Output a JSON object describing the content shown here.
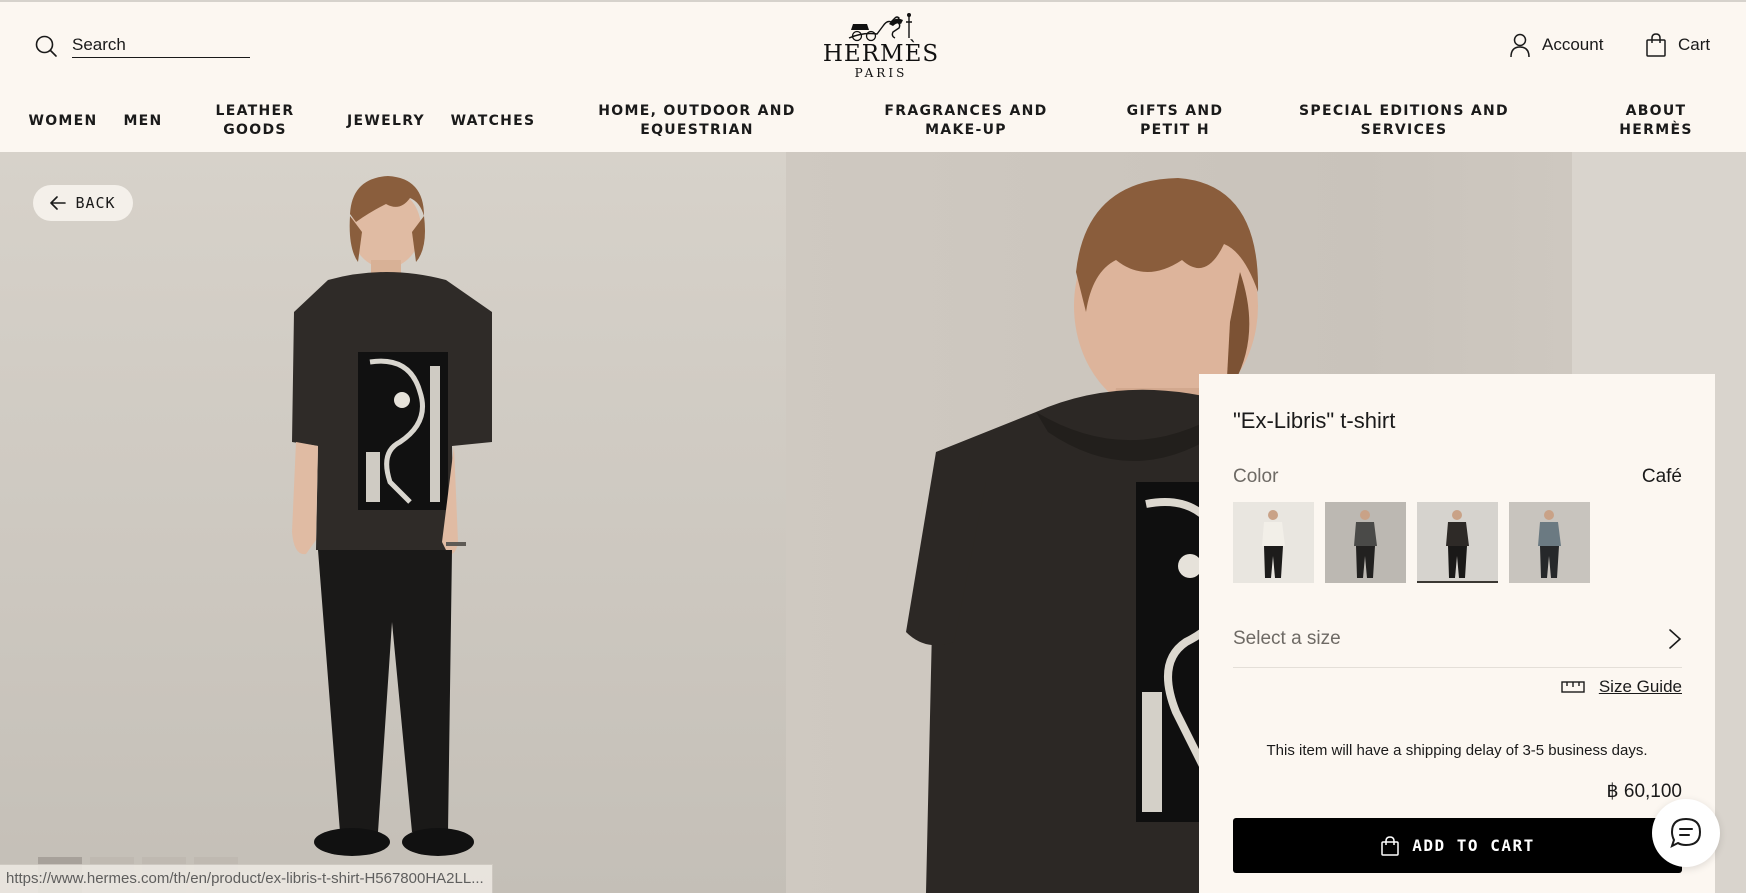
{
  "header": {
    "search": {
      "placeholder": "Search",
      "icon": "search-icon"
    },
    "logo": {
      "brand": "HERMÈS",
      "city": "PARIS"
    },
    "account": {
      "label": "Account",
      "icon": "user-icon"
    },
    "cart": {
      "label": "Cart",
      "icon": "shopping-bag-icon"
    }
  },
  "nav": [
    {
      "label": "WOMEN"
    },
    {
      "label": "MEN"
    },
    {
      "label": "LEATHER GOODS"
    },
    {
      "label": "JEWELRY"
    },
    {
      "label": "WATCHES"
    },
    {
      "label": "HOME, OUTDOOR AND EQUESTRIAN"
    },
    {
      "label": "FRAGRANCES AND MAKE-UP"
    },
    {
      "label": "GIFTS AND PETIT H"
    },
    {
      "label": "SPECIAL EDITIONS AND SERVICES"
    },
    {
      "label": "ABOUT HERMÈS"
    }
  ],
  "back": {
    "label": "BACK",
    "icon": "arrow-left-icon"
  },
  "product": {
    "title": "\"Ex-Libris\" t-shirt",
    "color_label": "Color",
    "color_value": "Café",
    "swatches": [
      {
        "name": "white",
        "colors": {
          "bg": "#e9e6e0",
          "shirt": "#f2efe8",
          "pants": "#1d1c1b"
        }
      },
      {
        "name": "grey",
        "colors": {
          "bg": "#bcb8b2",
          "shirt": "#4a4a48",
          "pants": "#222120"
        }
      },
      {
        "name": "cafe",
        "colors": {
          "bg": "#d6d3ce",
          "shirt": "#2e2a27",
          "pants": "#1a1918"
        }
      },
      {
        "name": "blue-grey",
        "colors": {
          "bg": "#c8c4be",
          "shirt": "#6b7a82",
          "pants": "#26282a"
        }
      }
    ],
    "selected_swatch": 2,
    "size_placeholder": "Select a size",
    "size_guide_label": "Size Guide",
    "shipping_note": "This item will have a shipping delay of 3-5 business days.",
    "price": "฿ 60,100",
    "add_to_cart_label": "ADD TO CART"
  },
  "chat": {
    "icon": "chat-bubble-icon"
  },
  "status_url": "https://www.hermes.com/th/en/product/ex-libris-t-shirt-H567800HA2LL..."
}
